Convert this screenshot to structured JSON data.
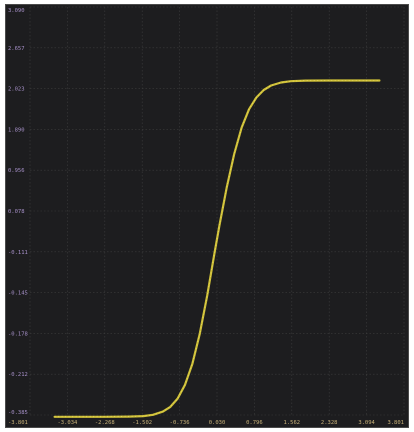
{
  "chart_data": {
    "type": "line",
    "title": "",
    "xlabel": "",
    "ylabel": "",
    "xlim": [
      -3.801,
      3.801
    ],
    "ylim": [
      -0.385,
      3.09
    ],
    "x_ticks": [
      "-3.801",
      "-3.034",
      "-2.268",
      "-1.502",
      "-0.736",
      "0.030",
      "0.796",
      "1.562",
      "2.328",
      "3.094",
      "3.801"
    ],
    "y_ticks": [
      "3.090",
      "2.657",
      "2.023",
      "1.890",
      "0.956",
      "0.078",
      "-0.111",
      "-0.145",
      "-0.178",
      "-0.212",
      "-0.385"
    ],
    "grid": true,
    "legend": "none",
    "colors": {
      "background": "#1d1d1f",
      "grid": "#3c3c3c",
      "line": "#e3d33a",
      "xtick": "#c8b27a",
      "ytick": "#a690c8"
    },
    "series": [
      {
        "x": [
          -3.3,
          -2.8,
          -2.3,
          -1.8,
          -1.5,
          -1.3,
          -1.1,
          -0.95,
          -0.8,
          -0.65,
          -0.5,
          -0.35,
          -0.2,
          -0.05,
          0.05,
          0.2,
          0.35,
          0.5,
          0.65,
          0.8,
          0.95,
          1.1,
          1.3,
          1.5,
          1.8,
          2.3,
          2.8,
          3.3
        ],
        "y": [
          -0.4,
          -0.4,
          -0.4,
          -0.399,
          -0.394,
          -0.383,
          -0.356,
          -0.316,
          -0.245,
          -0.128,
          0.052,
          0.308,
          0.632,
          0.994,
          1.232,
          1.556,
          1.838,
          2.062,
          2.219,
          2.319,
          2.383,
          2.421,
          2.447,
          2.458,
          2.463,
          2.464,
          2.464,
          2.464
        ]
      }
    ]
  }
}
